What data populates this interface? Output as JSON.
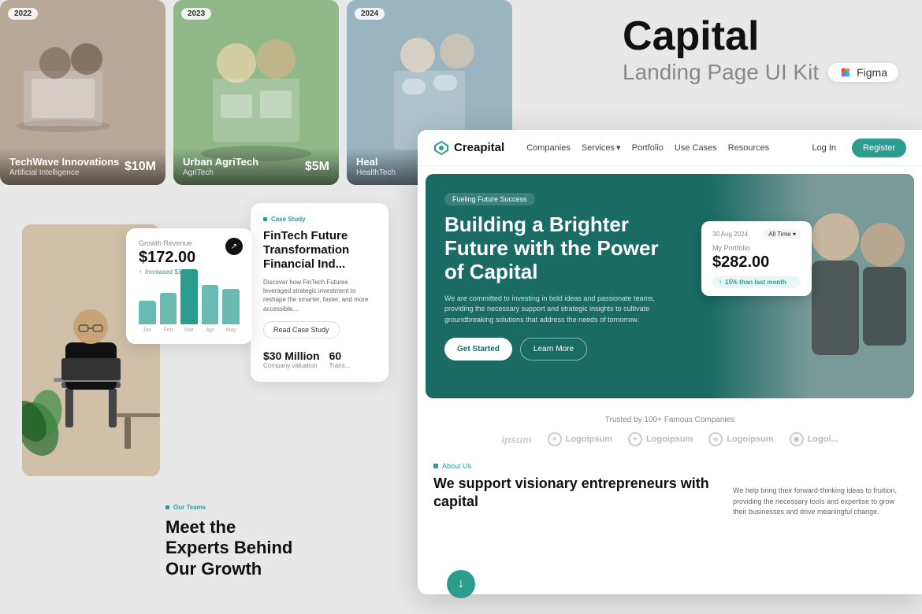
{
  "canvas": {
    "bg": "#e8e8e8"
  },
  "right_title": {
    "main": "Capital",
    "sub": "Landing Page UI Kit",
    "figma": "Figma"
  },
  "investment_cards": [
    {
      "year": "2022",
      "title": "TechWave Innovations",
      "sub": "Artificial Intelligence",
      "amount": "$10M",
      "photo_class": "card-photo-1"
    },
    {
      "year": "2023",
      "title": "Urban AgriTech",
      "sub": "AgriTech",
      "amount": "$5M",
      "photo_class": "card-photo-2"
    },
    {
      "year": "2024",
      "title": "Heal",
      "sub": "HealthTech",
      "amount": "",
      "photo_class": "card-photo-3"
    }
  ],
  "navbar": {
    "logo": "Creapital",
    "links": [
      "Companies",
      "Services",
      "Portfolio",
      "Use Cases",
      "Resources"
    ],
    "login": "Log In",
    "register": "Register"
  },
  "hero": {
    "tag": "Fueling Future Success",
    "title": "Building a Brighter Future with the Power of Capital",
    "desc": "We are committed to investing in bold ideas and passionate teams, providing the necessary support and strategic insights to cultivate groundbreaking solutions that address the needs of tomorrow.",
    "btn_primary": "Get Started",
    "btn_secondary": "Learn More"
  },
  "portfolio_card": {
    "date": "30 Aug 2024",
    "time": "All Time",
    "label": "My Portfolio",
    "amount": "$282.00",
    "change": "15% than last month"
  },
  "trusted": {
    "label": "Trusted by 100+ Famous Companies",
    "logos": [
      "ipsum",
      "Logoipsum",
      "Logoipsum",
      "Logoipsum",
      "Logoi..."
    ]
  },
  "about": {
    "tag": "About Us",
    "title": "We support visionary entrepreneurs with capital",
    "desc": "We help bring their forward-thinking ideas to fruition, providing the necessary tools and expertise to grow their businesses and drive meaningful change."
  },
  "growth_widget": {
    "label": "Growth Revenue",
    "amount": "$172.00",
    "change": "Increased $150",
    "months": [
      "Jan",
      "Feb",
      "Mar",
      "Apr",
      "May"
    ],
    "bars": [
      30,
      40,
      70,
      50,
      45
    ]
  },
  "case_study": {
    "tag": "Case Study",
    "title": "FinTech Future Transformation Financial Ind...",
    "desc": "Discover how FinTech Futures leveraged strategic investment to reshape the smarter, faster, and more accessible...",
    "cta": "Read Case Study",
    "stats": [
      {
        "value": "$30 Million",
        "label": "Company valuation"
      },
      {
        "value": "60",
        "label": "Trans..."
      }
    ]
  },
  "teams": {
    "tag": "Our Teams",
    "title": "Meet the Experts Behind Our Growth"
  }
}
